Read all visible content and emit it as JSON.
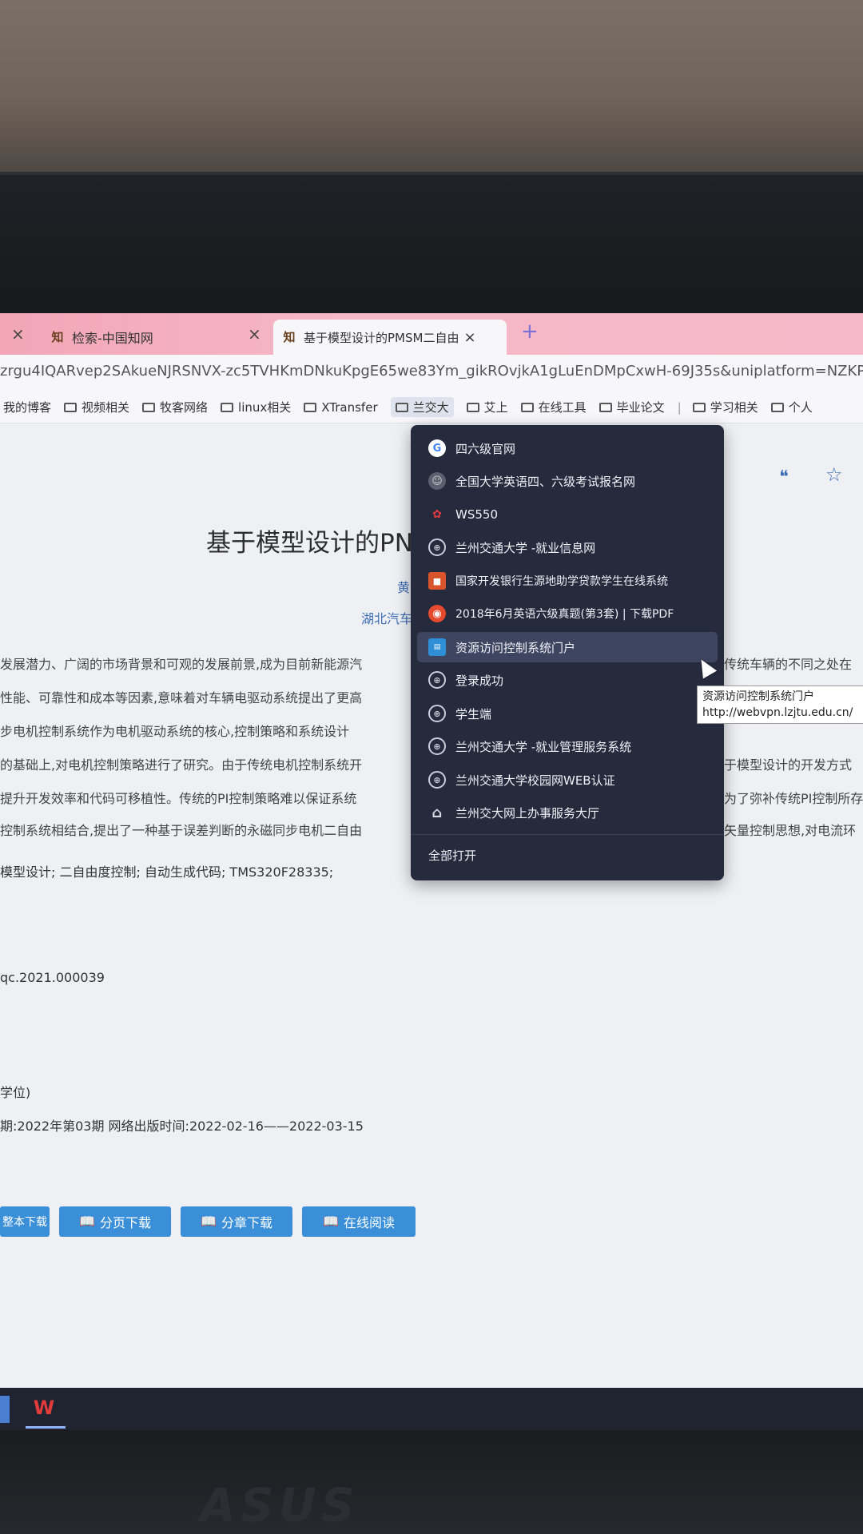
{
  "tabs": [
    {
      "title": "检索-中国知网"
    },
    {
      "title": "基于模型设计的PMSM二自由"
    }
  ],
  "new_tab_label": "+",
  "address": {
    "url": "zrgu4IQARvep2SAkueNJRSNVX-zc5TVHKmDNkuKpgE65we83Ym_gikROvjkA1gLuEnDMpCxwH-69J35s&uniplatform=NZKPT"
  },
  "bookmarks": [
    "我的博客",
    "视频相关",
    "牧客网络",
    "linux相关",
    "XTransfer",
    "兰交大",
    "艾上",
    "在线工具",
    "毕业论文",
    "学习相关",
    "个人"
  ],
  "dropdown": {
    "items": [
      {
        "label": "四六级官网",
        "icon": "google-icon"
      },
      {
        "label": "全国大学英语四、六级考试报名网",
        "icon": "cet-icon"
      },
      {
        "label": "WS550",
        "icon": "huawei-icon"
      },
      {
        "label": "兰州交通大学 -就业信息网",
        "icon": "globe-icon"
      },
      {
        "label": "国家开发银行生源地助学贷款学生在线系统",
        "icon": "bank-icon"
      },
      {
        "label": "2018年6月英语六级真题(第3套) | 下载PDF",
        "icon": "pdf-icon"
      },
      {
        "label": "资源访问控制系统门户",
        "icon": "portal-icon"
      },
      {
        "label": "登录成功",
        "icon": "globe-icon"
      },
      {
        "label": "学生端",
        "icon": "globe-icon"
      },
      {
        "label": "兰州交通大学 -就业管理服务系统",
        "icon": "globe-icon"
      },
      {
        "label": "兰州交通大学校园网WEB认证",
        "icon": "globe-icon"
      },
      {
        "label": "兰州交大网上办事服务大厅",
        "icon": "home-icon"
      }
    ],
    "open_all": "全部打开"
  },
  "tooltip": {
    "title": "资源访问控制系统门户",
    "url": "http://webvpn.lzjtu.edu.cn/"
  },
  "paper": {
    "title": "基于模型设计的PN",
    "author": "黄",
    "affiliation": "湖北汽车",
    "abstract_lines": [
      "发展潜力、广阔的市场背景和可观的发展前景,成为目前新能源汽",
      "性能、可靠性和成本等因素,意味着对车辆电驱动系统提出了更高",
      "步电机控制系统作为电机驱动系统的核心,控制策略和系统设计",
      "的基础上,对电机控制策略进行了研究。由于传统电机控制系统开",
      "提升开发效率和代码可移植性。传统的PI控制策略难以保证系统",
      "控制系统相结合,提出了一种基于误差判断的永磁同步电机二自由"
    ],
    "abstract_right_lines": [
      "传统车辆的不同之处在",
      "",
      "",
      "于模型设计的开发方式",
      "为了弥补传统PI控制所存",
      "矢量控制思想,对电流环"
    ],
    "keywords": "模型设计;  二自由度控制;  自动生成代码;  TMS320F28335;",
    "doi": "qc.2021.000039",
    "fragment": "学位)",
    "period": "期:2022年第03期     网络出版时间:2022-02-16——2022-03-15",
    "buttons": [
      "整本下载",
      "分页下载",
      "分章下载",
      "在线阅读"
    ]
  },
  "brand_text": "ASUS",
  "taskbar_wps": "W"
}
